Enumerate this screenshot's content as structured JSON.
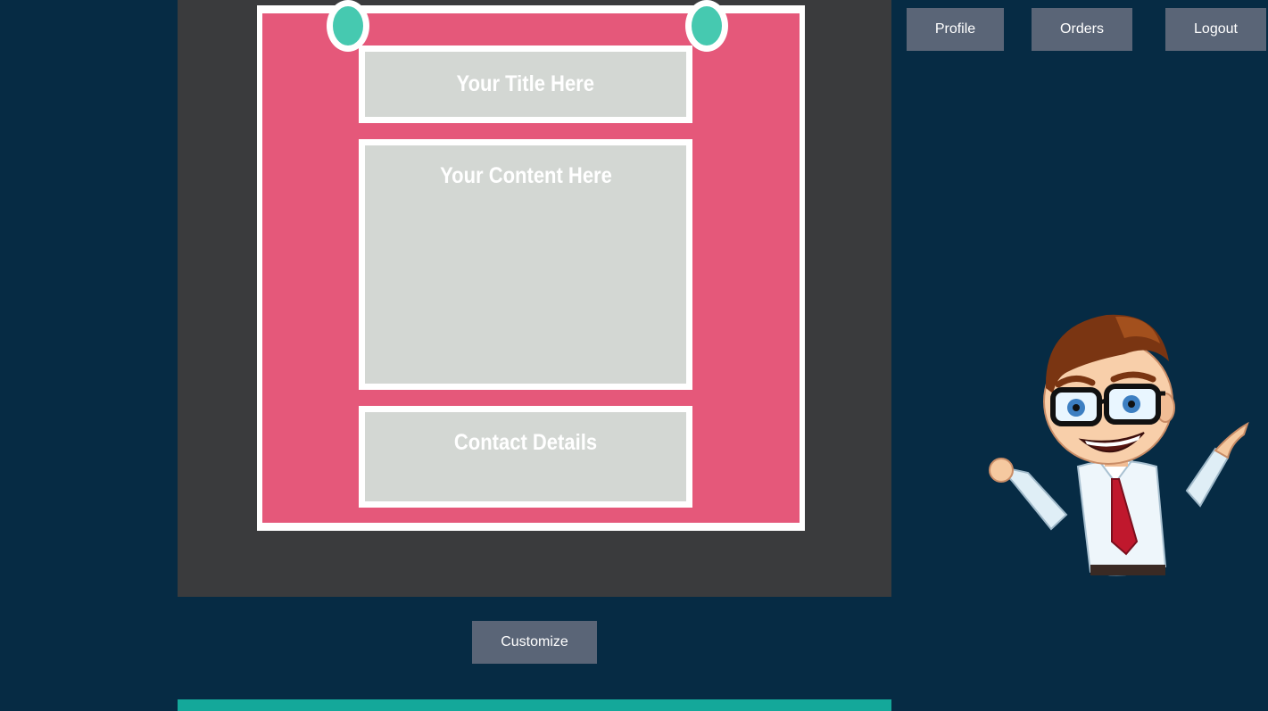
{
  "nav": {
    "profile_label": "Profile",
    "orders_label": "Orders",
    "logout_label": "Logout"
  },
  "template_preview": {
    "title_placeholder": "Your Title Here",
    "content_placeholder": "Your Content Here",
    "contact_placeholder": "Contact Details"
  },
  "actions": {
    "customize_label": "Customize"
  },
  "colors": {
    "page_background": "#062b44",
    "frame_background": "#3a3b3d",
    "poster_pink": "#e5587a",
    "pin_teal": "#46c9b0",
    "section_gray": "#d3d7d3",
    "button_slate": "#5a6577",
    "footer_teal": "#14a89a"
  },
  "icons": {
    "pin": "pushpin-icon",
    "mascot": "cartoon-businessman-illustration"
  }
}
